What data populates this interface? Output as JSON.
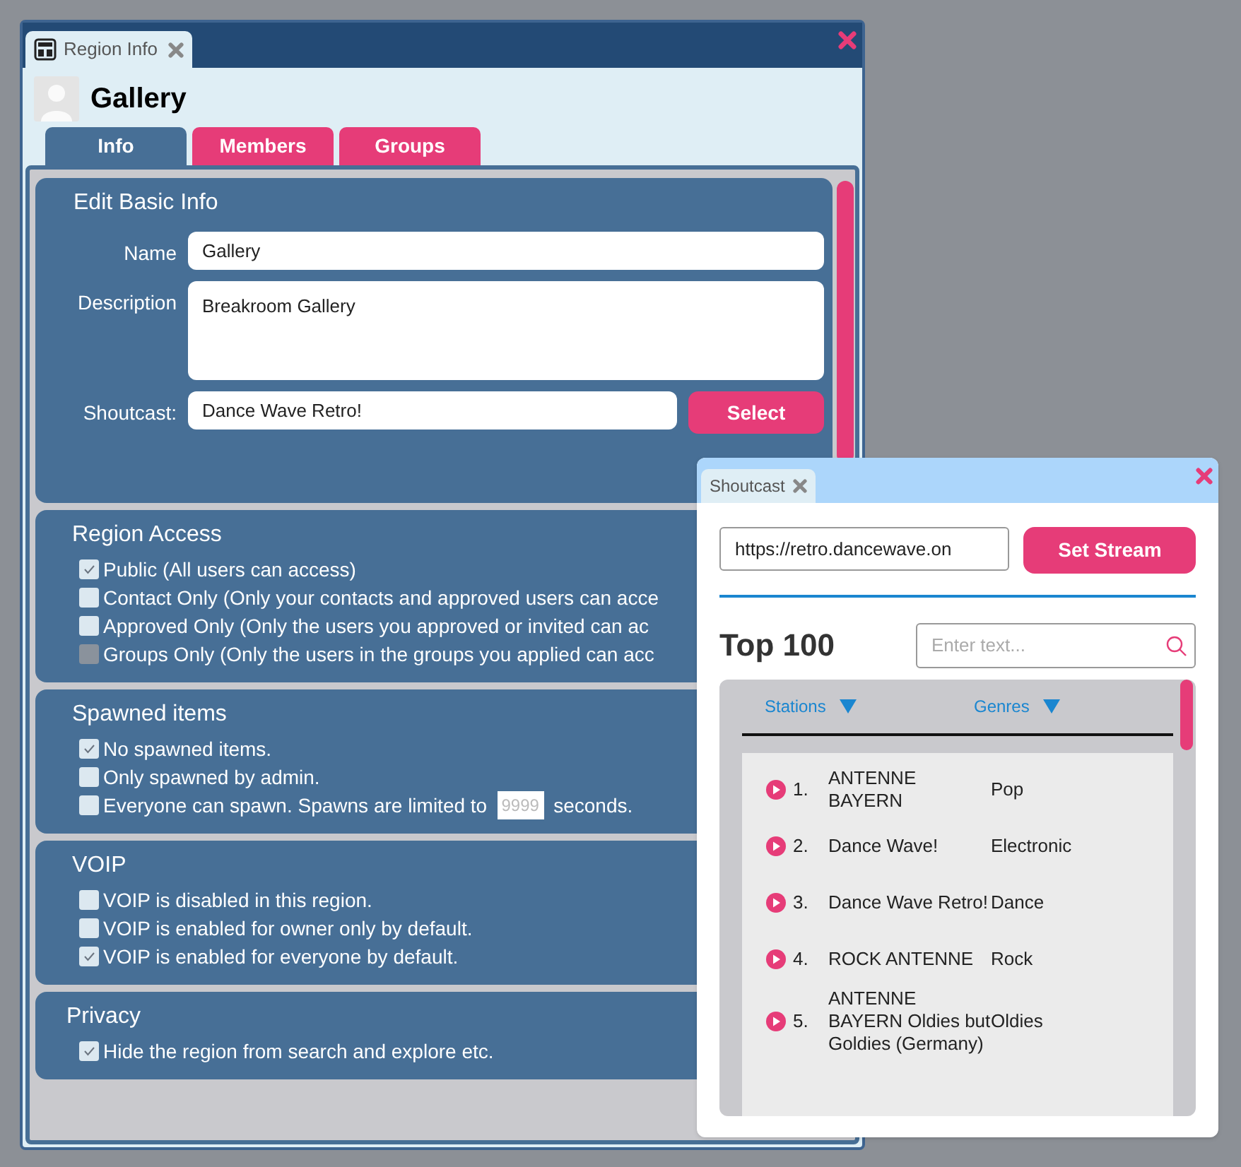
{
  "region_window": {
    "tab_title": "Region Info",
    "region_name": "Gallery",
    "tabs": [
      {
        "label": "Info",
        "selected": true
      },
      {
        "label": "Members",
        "selected": false
      },
      {
        "label": "Groups",
        "selected": false
      }
    ],
    "basic_info": {
      "title": "Edit Basic Info",
      "name_label": "Name",
      "name_value": "Gallery",
      "description_label": "Description",
      "description_value": "Breakroom Gallery",
      "shoutcast_label": "Shoutcast:",
      "shoutcast_value": "Dance Wave Retro!",
      "select_button": "Select"
    },
    "sections": [
      {
        "title": "Region Access",
        "options": [
          {
            "label": "Public (All users can access)",
            "checked": true,
            "disabled": false
          },
          {
            "label": "Contact Only (Only your contacts and approved users can acce",
            "checked": false,
            "disabled": false
          },
          {
            "label": "Approved Only (Only the users you approved or invited can ac",
            "checked": false,
            "disabled": false
          },
          {
            "label": "Groups Only (Only the users in the groups you applied can acc",
            "checked": false,
            "disabled": true
          }
        ]
      },
      {
        "title": "Spawned items",
        "options": [
          {
            "label": "No spawned items.",
            "checked": true,
            "disabled": false
          },
          {
            "label": "Only spawned by admin.",
            "checked": false,
            "disabled": false
          },
          {
            "label": "Everyone can spawn. Spawns are limited to",
            "checked": false,
            "disabled": false,
            "field_placeholder": "9999",
            "suffix": "seconds."
          }
        ]
      },
      {
        "title": "VOIP",
        "options": [
          {
            "label": "VOIP is disabled in this region.",
            "checked": false,
            "disabled": false
          },
          {
            "label": "VOIP is enabled for owner only by default.",
            "checked": false,
            "disabled": false
          },
          {
            "label": "VOIP is enabled for everyone by default.",
            "checked": true,
            "disabled": false
          }
        ]
      },
      {
        "title": "Privacy",
        "options": [
          {
            "label": "Hide the region from search and explore etc.",
            "checked": true,
            "disabled": false
          }
        ]
      }
    ]
  },
  "shoutcast_window": {
    "tab_title": "Shoutcast",
    "stream_url": "https://retro.dancewave.on",
    "set_stream_button": "Set Stream",
    "list_title": "Top 100",
    "search_placeholder": "Enter text...",
    "columns": [
      "Stations",
      "Genres"
    ],
    "stations": [
      {
        "rank": "1.",
        "name": "ANTENNE BAYERN",
        "genre": "Pop"
      },
      {
        "rank": "2.",
        "name": "Dance Wave!",
        "genre": "Electronic"
      },
      {
        "rank": "3.",
        "name": "Dance Wave Retro!",
        "genre": "Dance"
      },
      {
        "rank": "4.",
        "name": "ROCK ANTENNE",
        "genre": "Rock"
      },
      {
        "rank": "5.",
        "name": "ANTENNE BAYERN Oldies but Goldies (Germany)",
        "genre": "Oldies"
      }
    ]
  }
}
